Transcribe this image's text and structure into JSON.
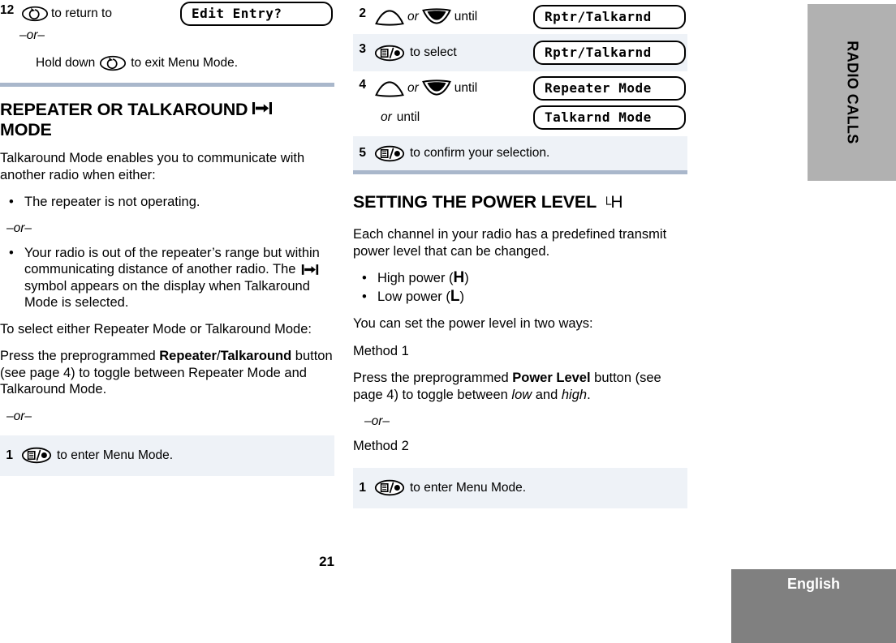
{
  "page": {
    "number": "21",
    "chapter_tab": "RADIO CALLS",
    "language_tab": "English"
  },
  "left_column": {
    "continued_step": {
      "number": "12",
      "icon": "menu-return-button-icon",
      "text_after_icon": "to return to",
      "lcd": "Edit Entry?",
      "or": "–or–",
      "hold_text_before": "Hold down",
      "hold_text_after": "to exit Menu Mode."
    },
    "heading": {
      "line1": "REPEATER OR TALKAROUND",
      "line2": "MODE",
      "symbol": "talkaround-symbol"
    },
    "intro": "Talkaround Mode enables you to communicate with another radio when either:",
    "bullets": [
      "The repeater is not operating.",
      "Your radio is out of the repeater’s range but within communicating distance of another radio. The "
    ],
    "bullet2_tail": " symbol appears on the display when Talkaround Mode is selected.",
    "bullet_separator": "–or–",
    "select_intro": "To select either Repeater Mode or Talkaround Mode:",
    "press_paragraph": {
      "p1": "Press the preprogrammed ",
      "bold1": "Repeater",
      "slash": "/",
      "bold2": "Talkaround",
      "p2": " button (see page 4) to toggle between Repeater Mode and Talkaround Mode."
    },
    "or": "–or–",
    "step1": {
      "number": "1",
      "icon": "menu-select-button-icon",
      "text": "to enter Menu Mode."
    }
  },
  "right_column": {
    "steps": [
      {
        "number": "2",
        "icons": [
          "up-arrow-button-icon",
          "down-arrow-button-icon"
        ],
        "text_mid": "or",
        "text_end": "until",
        "lcd": "Rptr/Talkarnd",
        "shaded": false
      },
      {
        "number": "3",
        "icons": [
          "menu-select-button-icon"
        ],
        "text_end": "to select",
        "lcd": "Rptr/Talkarnd",
        "shaded": true
      },
      {
        "number": "4",
        "icons": [
          "up-arrow-button-icon",
          "down-arrow-button-icon"
        ],
        "text_mid": "or",
        "text_end": "until",
        "lcd": "Repeater Mode",
        "sub_text_italic": "or",
        "sub_text": "until",
        "sub_lcd": "Talkarnd Mode",
        "shaded": false
      },
      {
        "number": "5",
        "icons": [
          "menu-select-button-icon"
        ],
        "text_end": "to confirm your selection.",
        "lcd": "",
        "shaded": true
      }
    ],
    "heading": {
      "text": "SETTING THE POWER LEVEL",
      "symbol": "power-level-low-high-symbol"
    },
    "intro": "Each channel in your radio has a predefined transmit power level that can be changed.",
    "bullets": [
      {
        "label": "High power (",
        "glyph": "H",
        "tail": ")"
      },
      {
        "label": "Low power  (",
        "glyph": "L",
        "tail": ")"
      }
    ],
    "two_ways": "You can set the power level in two ways:",
    "method1_label": "Method 1",
    "method1": {
      "p1": "Press the preprogrammed ",
      "bold": "Power Level",
      "p2": " button (see page 4) to toggle between ",
      "ital1": "low",
      "p3": " and ",
      "ital2": "high",
      "p4": "."
    },
    "or": "–or–",
    "method2_label": "Method 2",
    "step1": {
      "number": "1",
      "icon": "menu-select-button-icon",
      "text": "to enter Menu Mode."
    }
  },
  "colors": {
    "rule_blue": "#a9b7cb",
    "row_shade": "#eef2f7",
    "chapter_tab_gray": "#b1b1b1",
    "language_tab_gray": "#808080"
  }
}
